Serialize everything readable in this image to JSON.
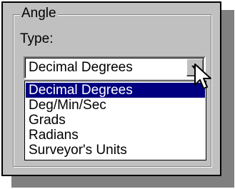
{
  "group": {
    "title": "Angle"
  },
  "type_label": "Type:",
  "combo": {
    "selected_value": "Decimal Degrees",
    "dropdown_icon": "chevron-down-icon"
  },
  "list": {
    "items": [
      "Decimal Degrees",
      "Deg/Min/Sec",
      "Grads",
      "Radians",
      "Surveyor's Units"
    ],
    "selected_index": 0
  },
  "cursor": {
    "icon": "arrow-cursor-icon"
  },
  "colors": {
    "panel": "#c0c0c0",
    "shadow": "#808080",
    "selection": "#000080"
  }
}
